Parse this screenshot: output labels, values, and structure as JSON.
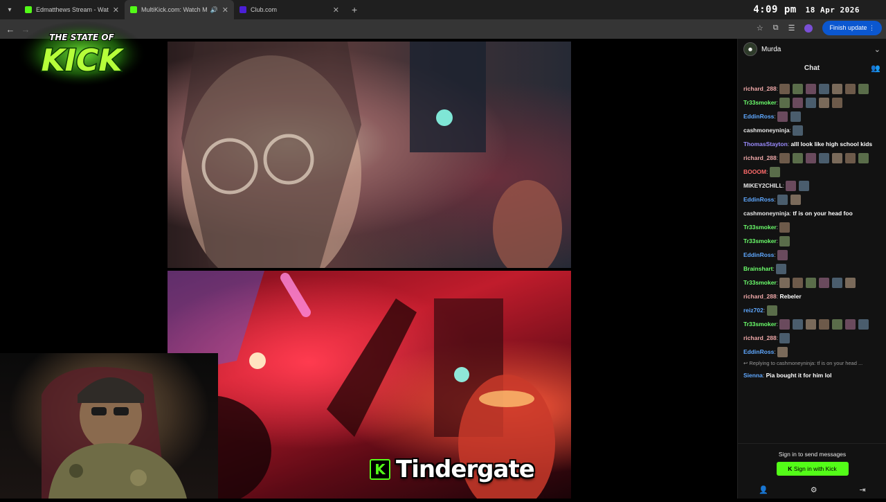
{
  "browser": {
    "tabs": [
      {
        "label": "Edmatthews Stream - Watch Li",
        "favicon_color": "#53fc18",
        "active": false
      },
      {
        "label": "MultiKick.com: Watch Multi",
        "favicon_color": "#53fc18",
        "active": true
      },
      {
        "label": "Club.com",
        "favicon_color": "#4b1fd6",
        "active": false
      }
    ],
    "new_tab": "+",
    "clock_time": "4:09 pm",
    "clock_date": "18 Apr 2026",
    "update_button": "Finish update"
  },
  "logo": {
    "line1": "THE STATE OF",
    "line2": "KICK"
  },
  "overlay": {
    "badge": "K",
    "title": "Tindergate"
  },
  "chat": {
    "streamer": "Murda",
    "title": "Chat",
    "messages": [
      {
        "user": "richard_288",
        "color": "#f0a9a9",
        "text": "",
        "emotes": 7
      },
      {
        "user": "Tr33smoker",
        "color": "#6cff6c",
        "text": "",
        "emotes": 5
      },
      {
        "user": "EddinRoss",
        "color": "#5fa8ff",
        "text": "",
        "emotes": 2
      },
      {
        "user": "cashmoneyninja",
        "color": "#e8e8e8",
        "text": "",
        "emotes": 1
      },
      {
        "user": "ThomasStayton",
        "color": "#9b8cff",
        "text": "alll look like high school kids",
        "emotes": 0
      },
      {
        "user": "richard_288",
        "color": "#f0a9a9",
        "text": "",
        "emotes": 7
      },
      {
        "user": "BOOOM",
        "color": "#ff6b6b",
        "text": "",
        "emotes": 1
      },
      {
        "user": "MIKEY2CHILL",
        "color": "#e8e8e8",
        "text": "",
        "emotes": 2
      },
      {
        "user": "EddinRoss",
        "color": "#5fa8ff",
        "text": "",
        "emotes": 2
      },
      {
        "user": "cashmoneyninja",
        "color": "#e8e8e8",
        "text": "tf is on your head foo",
        "emotes": 0
      },
      {
        "user": "Tr33smoker",
        "color": "#6cff6c",
        "text": "",
        "emotes": 1
      },
      {
        "user": "Tr33smoker",
        "color": "#6cff6c",
        "text": "",
        "emotes": 1
      },
      {
        "user": "EddinRoss",
        "color": "#5fa8ff",
        "text": "",
        "emotes": 1
      },
      {
        "user": "Brainshart",
        "color": "#6cff6c",
        "text": "",
        "emotes": 1
      },
      {
        "user": "Tr33smoker",
        "color": "#6cff6c",
        "text": "",
        "emotes": 6
      },
      {
        "user": "richard_288",
        "color": "#f0a9a9",
        "text": "Rebeler",
        "emotes": 0
      },
      {
        "user": "reiz702",
        "color": "#5fa8ff",
        "text": "",
        "emotes": 1
      },
      {
        "user": "Tr33smoker",
        "color": "#6cff6c",
        "text": "",
        "emotes": 7
      },
      {
        "user": "richard_288",
        "color": "#f0a9a9",
        "text": "",
        "emotes": 1
      },
      {
        "user": "EddinRoss",
        "color": "#5fa8ff",
        "text": "",
        "emotes": 1
      }
    ],
    "reply_to": "Replying to cashmoneyninja: tf is on your head ...",
    "last_message": {
      "user": "Sienna",
      "color": "#5fa8ff",
      "text": "Pia bought it for him lol"
    },
    "signin_prompt": "Sign in to send messages",
    "signin_button": "Sign in with Kick"
  }
}
